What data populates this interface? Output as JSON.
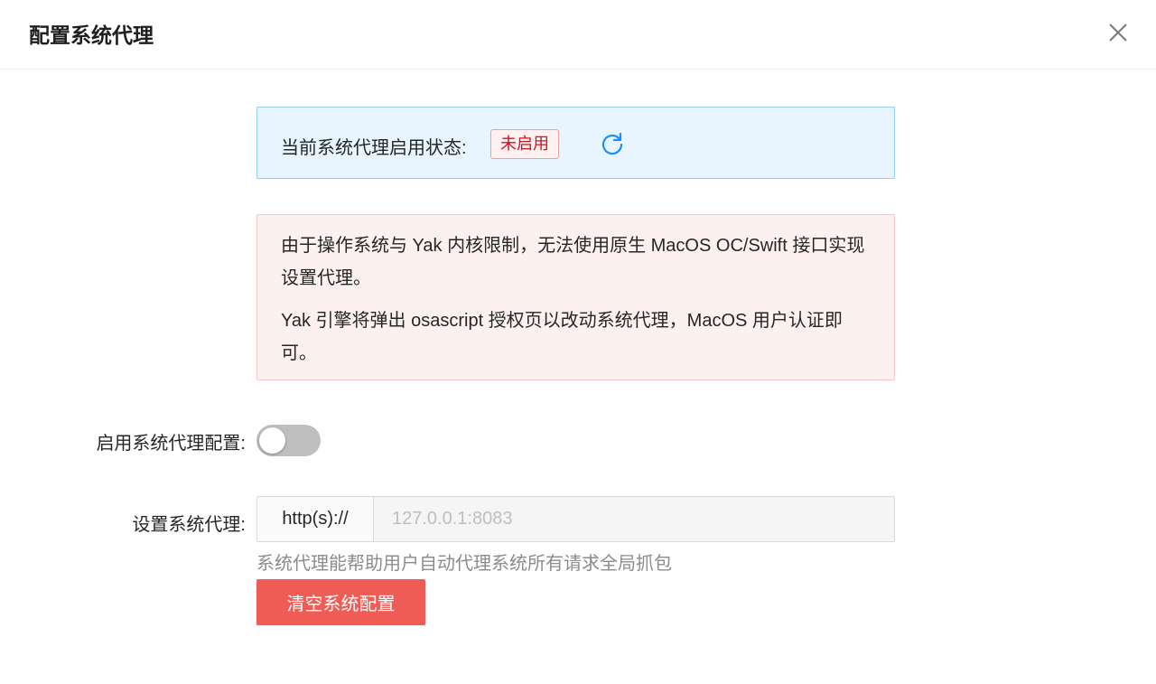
{
  "modal": {
    "title": "配置系统代理",
    "close_icon": "close-icon"
  },
  "status": {
    "label": "当前系统代理启用状态:",
    "tag": "未启用",
    "tag_color": "#cf1322",
    "refresh_icon": "refresh-icon"
  },
  "warning": {
    "paragraphs": [
      "由于操作系统与 Yak 内核限制，无法使用原生 MacOS OC/Swift 接口实现设置代理。",
      "Yak 引擎将弹出 osascript 授权页以改动系统代理，MacOS 用户认证即可。"
    ]
  },
  "form": {
    "enable_label": "启用系统代理配置:",
    "enabled": false,
    "proxy_label": "设置系统代理:",
    "proxy_prefix": "http(s)://",
    "proxy_value": "",
    "proxy_placeholder": "127.0.0.1:8083",
    "help": "系统代理能帮助用户自动代理系统所有请求全局抓包",
    "clear_button": "清空系统配置",
    "clear_button_color": "#ef5b55"
  }
}
